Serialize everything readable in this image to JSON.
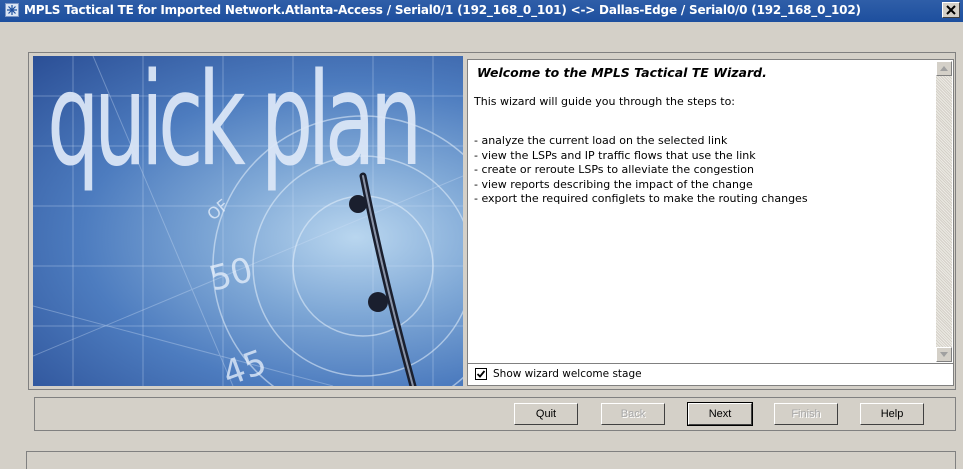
{
  "window": {
    "title": "MPLS Tactical TE  for Imported Network.Atlanta-Access / Serial0/1 (192_168_0_101) <-> Dallas-Edge / Serial0/0 (192_168_0_102)"
  },
  "banner": {
    "text": "quick plan"
  },
  "welcome": {
    "title": "Welcome to the MPLS Tactical TE Wizard.",
    "intro": "This wizard will guide you through the steps to:",
    "steps": [
      "- analyze the current load on the selected link",
      "- view the LSPs and IP traffic flows that use the link",
      "- create or reroute LSPs to alleviate the congestion",
      "- view reports describing the impact of the change",
      "- export the required configlets to make the routing changes"
    ]
  },
  "options": {
    "show_welcome_label": "Show wizard welcome stage",
    "show_welcome_checked": true
  },
  "buttons": {
    "quit": "Quit",
    "back": "Back",
    "next": "Next",
    "finish": "Finish",
    "help": "Help"
  },
  "colors": {
    "titlebar": "#1d4f9e",
    "dialog_bg": "#d4d0c8",
    "disabled_text": "#a8a8a8"
  }
}
